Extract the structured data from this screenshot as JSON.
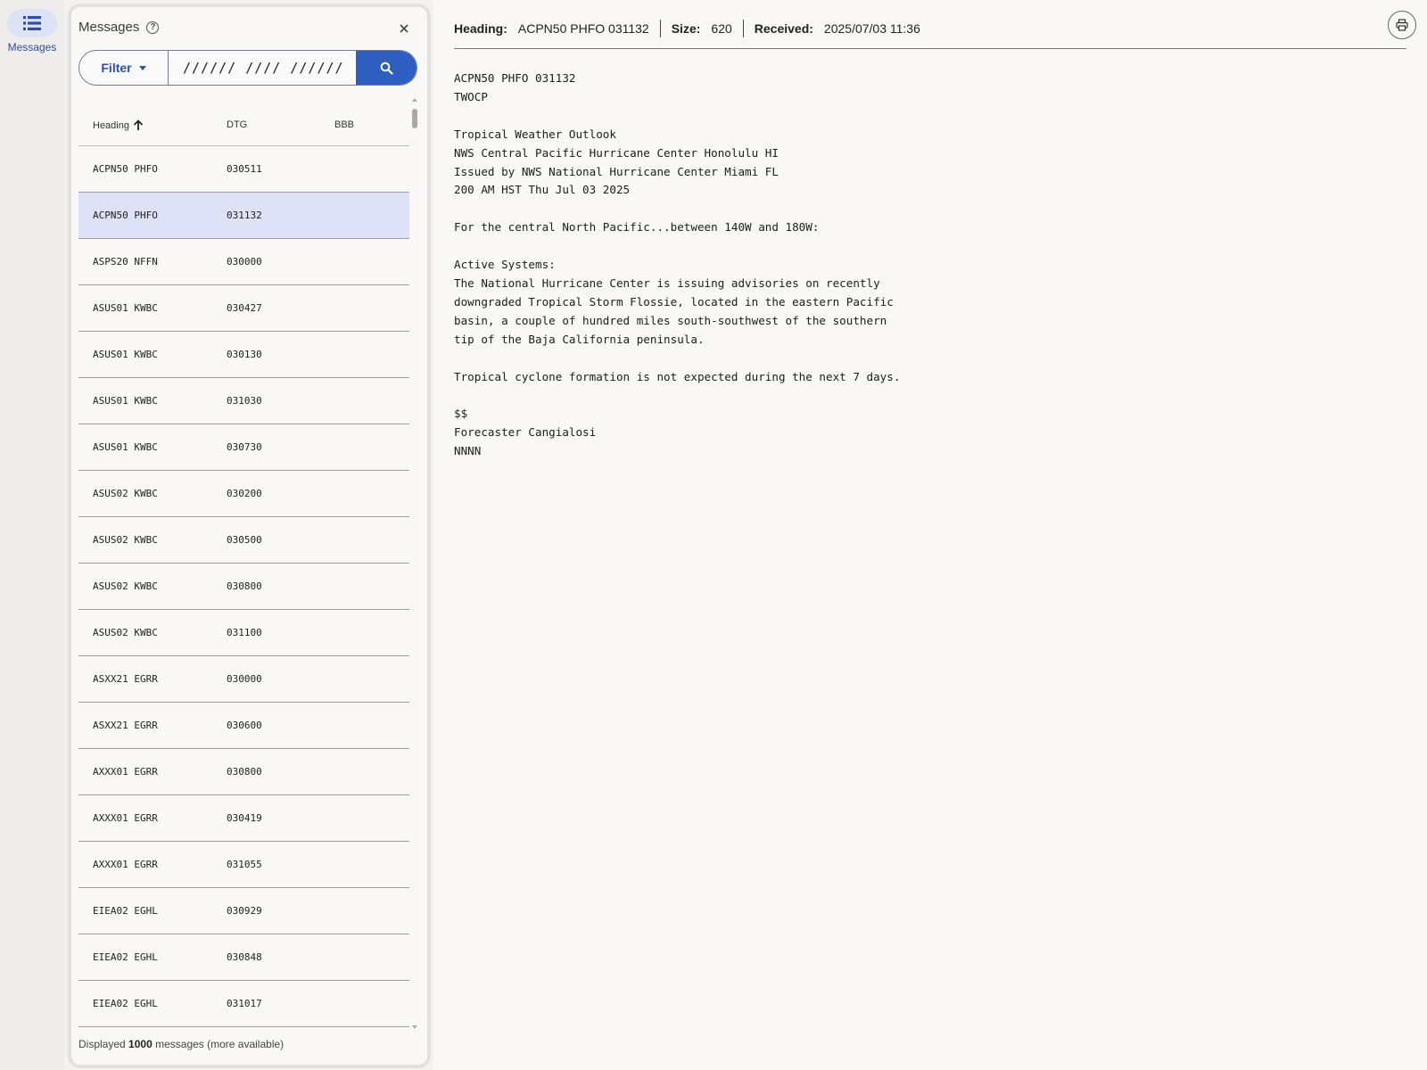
{
  "nav": {
    "messages_label": "Messages"
  },
  "panel": {
    "title": "Messages",
    "filter_label": "Filter",
    "search_value": "////// //// //////",
    "columns": {
      "heading": "Heading",
      "dtg": "DTG",
      "bbb": "BBB"
    },
    "rows": [
      {
        "heading": "ACPN50 PHFO",
        "dtg": "030511",
        "bbb": ""
      },
      {
        "heading": "ACPN50 PHFO",
        "dtg": "031132",
        "bbb": ""
      },
      {
        "heading": "ASPS20 NFFN",
        "dtg": "030000",
        "bbb": ""
      },
      {
        "heading": "ASUS01 KWBC",
        "dtg": "030427",
        "bbb": ""
      },
      {
        "heading": "ASUS01 KWBC",
        "dtg": "030130",
        "bbb": ""
      },
      {
        "heading": "ASUS01 KWBC",
        "dtg": "031030",
        "bbb": ""
      },
      {
        "heading": "ASUS01 KWBC",
        "dtg": "030730",
        "bbb": ""
      },
      {
        "heading": "ASUS02 KWBC",
        "dtg": "030200",
        "bbb": ""
      },
      {
        "heading": "ASUS02 KWBC",
        "dtg": "030500",
        "bbb": ""
      },
      {
        "heading": "ASUS02 KWBC",
        "dtg": "030800",
        "bbb": ""
      },
      {
        "heading": "ASUS02 KWBC",
        "dtg": "031100",
        "bbb": ""
      },
      {
        "heading": "ASXX21 EGRR",
        "dtg": "030000",
        "bbb": ""
      },
      {
        "heading": "ASXX21 EGRR",
        "dtg": "030600",
        "bbb": ""
      },
      {
        "heading": "AXXX01 EGRR",
        "dtg": "030800",
        "bbb": ""
      },
      {
        "heading": "AXXX01 EGRR",
        "dtg": "030419",
        "bbb": ""
      },
      {
        "heading": "AXXX01 EGRR",
        "dtg": "031055",
        "bbb": ""
      },
      {
        "heading": "EIEA02 EGHL",
        "dtg": "030929",
        "bbb": ""
      },
      {
        "heading": "EIEA02 EGHL",
        "dtg": "030848",
        "bbb": ""
      },
      {
        "heading": "EIEA02 EGHL",
        "dtg": "031017",
        "bbb": ""
      }
    ],
    "selected_row": 1,
    "footer_prefix": "Displayed",
    "footer_count": "1000",
    "footer_suffix": "messages (more available)"
  },
  "detail": {
    "heading_label": "Heading:",
    "heading_value": "ACPN50 PHFO 031132",
    "size_label": "Size:",
    "size_value": "620",
    "received_label": "Received:",
    "received_value": "2025/07/03 11:36",
    "body": "ACPN50 PHFO 031132\nTWOCP\n\nTropical Weather Outlook\nNWS Central Pacific Hurricane Center Honolulu HI\nIssued by NWS National Hurricane Center Miami FL\n200 AM HST Thu Jul 03 2025\n\nFor the central North Pacific...between 140W and 180W:\n\nActive Systems:\nThe National Hurricane Center is issuing advisories on recently\ndowngraded Tropical Storm Flossie, located in the eastern Pacific\nbasin, a couple of hundred miles south-southwest of the southern\ntip of the Baja California peninsula.\n\nTropical cyclone formation is not expected during the next 7 days.\n\n$$\nForecaster Cangialosi\nNNNN"
  },
  "icons": {
    "nav": "list-icon",
    "help": "help-circle-icon",
    "close": "close-icon",
    "filter": "chevron-down-icon",
    "search": "search-icon",
    "sort": "arrow-up-icon",
    "print": "print-icon"
  },
  "colors": {
    "accent": "#2e5fc0",
    "selected_row": "#dde2f6",
    "nav_pill": "#dde3f7"
  }
}
